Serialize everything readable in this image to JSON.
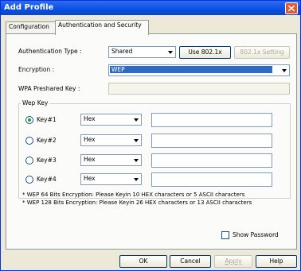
{
  "window": {
    "title": "Add Profile"
  },
  "tabs": [
    {
      "label": "Configuration"
    },
    {
      "label": "Authentication and Security"
    }
  ],
  "auth": {
    "type_label": "Authentication Type :",
    "type_value": "Shared",
    "use8021x_label": "Use 802.1x",
    "setting8021x_label": "802.1x Setting"
  },
  "encryption": {
    "label": "Encryption :",
    "value": "WEP"
  },
  "wpa": {
    "label": "WPA Preshared Key :",
    "value": ""
  },
  "wep": {
    "group_label": "Wep Key",
    "keys": [
      {
        "label": "Key#1",
        "format": "Hex",
        "value": "",
        "selected": true
      },
      {
        "label": "Key#2",
        "format": "Hex",
        "value": "",
        "selected": false
      },
      {
        "label": "Key#3",
        "format": "Hex",
        "value": "",
        "selected": false
      },
      {
        "label": "Key#4",
        "format": "Hex",
        "value": "",
        "selected": false
      }
    ]
  },
  "notes": {
    "line1": "* WEP 64 Bits Encryption:  Please Keyin 10 HEX characters or 5 ASCII characters",
    "line2": "* WEP 128 Bits Encryption:  Please Keyin 26 HEX characters or 13 ASCII characters"
  },
  "show_password": {
    "label": "Show Password",
    "checked": false
  },
  "buttons": {
    "ok": "OK",
    "cancel": "Cancel",
    "apply": "Apply",
    "help": "Help"
  },
  "colors": {
    "titlebar": "#0a4fe0",
    "window_bg": "#ece9d8",
    "selection": "#316ac5"
  }
}
